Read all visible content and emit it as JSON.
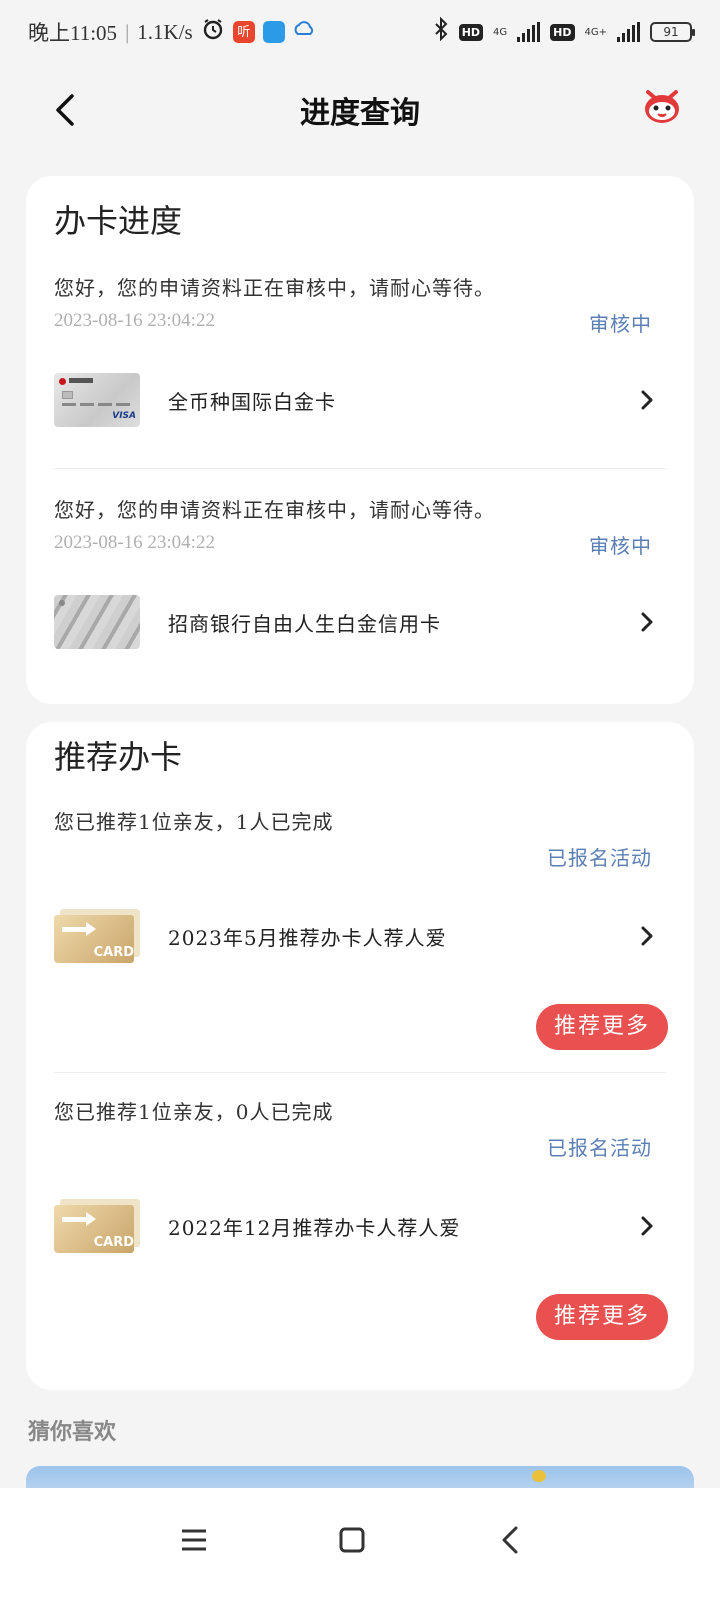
{
  "status_bar": {
    "time": "晚上11:05",
    "net_speed": "1.1K/s",
    "network_1": "4G",
    "network_2": "4G+",
    "hd": "HD",
    "battery": "91"
  },
  "header": {
    "title": "进度查询",
    "back_icon": "chevron-left-icon",
    "mascot_icon": "mascot-icon"
  },
  "progress": {
    "title": "办卡进度",
    "items": [
      {
        "message": "您好，您的申请资料正在审核中，请耐心等待。",
        "timestamp": "2023-08-16  23:04:22",
        "status": "审核中",
        "card_name": "全币种国际白金卡"
      },
      {
        "message": "您好，您的申请资料正在审核中，请耐心等待。",
        "timestamp": "2023-08-16  23:04:22",
        "status": "审核中",
        "card_name": "招商银行自由人生白金信用卡"
      }
    ]
  },
  "recommend": {
    "title": "推荐办卡",
    "items": [
      {
        "summary": "您已推荐1位亲友，1人已完成",
        "status": "已报名活动",
        "campaign": "2023年5月推荐办卡人荐人爱",
        "cta": "推荐更多",
        "thumb_text": "CARD"
      },
      {
        "summary": "您已推荐1位亲友，0人已完成",
        "status": "已报名活动",
        "campaign": "2022年12月推荐办卡人荐人爱",
        "cta": "推荐更多",
        "thumb_text": "CARD"
      }
    ]
  },
  "guess": {
    "title": "猜你喜欢"
  },
  "colors": {
    "accent_blue": "#5b7fb5",
    "cta_red": "#e8514f",
    "background": "#f4f4f4"
  }
}
